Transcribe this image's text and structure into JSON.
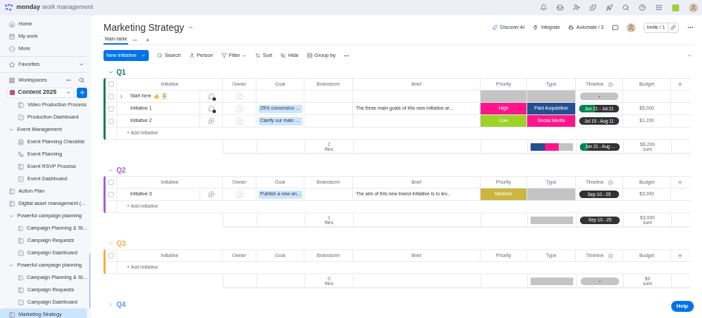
{
  "top_bar": {
    "brand": "monday",
    "product": "work management"
  },
  "sidebar": {
    "nav": [
      {
        "label": "Home",
        "kind": "home"
      },
      {
        "label": "My work",
        "kind": "mywork"
      },
      {
        "label": "More",
        "kind": "more"
      }
    ],
    "favorites": "Favorites",
    "workspaces": "Workspaces",
    "workspace": "Content 2025",
    "items": [
      {
        "label": "Video Production Process",
        "kind": "board",
        "selected": false
      },
      {
        "label": "Production Dashboard",
        "kind": "dashboard",
        "selected": false
      },
      {
        "label": "Event Management",
        "kind": "folder",
        "selected": false,
        "expanded": true,
        "children": [
          {
            "label": "Event Planning Checklist",
            "kind": "doc",
            "selected": false
          },
          {
            "label": "Event Planning",
            "kind": "workflow",
            "selected": false
          },
          {
            "label": "Event RSVP Process",
            "kind": "board",
            "selected": false
          },
          {
            "label": "Event Dashboard",
            "kind": "dashboard",
            "selected": false
          }
        ]
      },
      {
        "label": "Action Plan",
        "kind": "board",
        "selected": false
      },
      {
        "label": "Digital asset management (...",
        "kind": "board",
        "selected": false
      },
      {
        "label": "Powerful campaign planning",
        "kind": "folder",
        "selected": false,
        "expanded": true,
        "children": [
          {
            "label": "Campaign Planning & St...",
            "kind": "board",
            "selected": false
          },
          {
            "label": "Campaign Requests",
            "kind": "board",
            "selected": false
          },
          {
            "label": "Campaign Dashboard",
            "kind": "dashboard",
            "selected": false
          }
        ]
      },
      {
        "label": "Powerful campaign planning",
        "kind": "folder",
        "selected": false,
        "expanded": true,
        "children": [
          {
            "label": "Campaign Planning & St...",
            "kind": "board",
            "selected": false
          },
          {
            "label": "Campaign Requests",
            "kind": "board",
            "selected": false
          },
          {
            "label": "Campaign Dashboard",
            "kind": "dashboard",
            "selected": false
          }
        ]
      },
      {
        "label": "Marketing Strategy",
        "kind": "board",
        "selected": true
      }
    ]
  },
  "board": {
    "title": "Marketing Strategy",
    "actions": [
      "Discover AI",
      "Integrate",
      "Automate / 3"
    ],
    "invite": "Invite / 1",
    "tabs": [
      {
        "label": "Main table",
        "selected": true
      }
    ],
    "toolbar": {
      "primary": "New initiative",
      "items": [
        "Search",
        "Person",
        "Filter",
        "Sort",
        "Hide",
        "Group by"
      ]
    }
  },
  "groups": [
    {
      "title": "Q1",
      "color": "#037f4c",
      "expanded": true,
      "all_checked": false,
      "columns": [
        "Initiative",
        "Owner",
        "Goal",
        "Brainstorm",
        "Brief",
        "Priority",
        "Type",
        "Timeline",
        "Budget"
      ],
      "add_label": "+ Add initiative",
      "rows": [
        {
          "name": "Start here",
          "checked": false,
          "expandable": true,
          "count": "1",
          "has_updates": true,
          "priority": {
            "color": "#c4c4c4"
          },
          "type": {
            "color": "#c4c4c4"
          },
          "timeline": {
            "kind": "empty",
            "label": "-"
          }
        },
        {
          "name": "Initiative 1",
          "checked": false,
          "has_updates": true,
          "goal": "25% conversion ...",
          "brief": "The three main goals of this new initiative ar...",
          "priority": {
            "label": "High",
            "color": "#ff158a"
          },
          "type": {
            "label": "Paid Acquisition",
            "color": "#225091"
          },
          "timeline": {
            "kind": "range",
            "label": "Jun 21 - Jul 21",
            "level": 0.4
          },
          "budget": "$5,000"
        },
        {
          "name": "Initiative 2",
          "checked": false,
          "has_updates": false,
          "goal": "Clarify our main ...",
          "priority": {
            "label": "Low",
            "color": "#9cd326"
          },
          "type": {
            "label": "Social Media",
            "color": "#ff158a"
          },
          "timeline": {
            "kind": "range",
            "label": "Jul 15 - Aug 11"
          },
          "budget": "$1,200"
        }
      ],
      "summary": {
        "files": "2",
        "files_label": "files",
        "type_mix": [
          {
            "color": "#225091"
          },
          {
            "color": "#ff158a"
          },
          {
            "color": "#c4c4c4"
          }
        ],
        "timeline": {
          "kind": "range",
          "label": "Jun 21 - Aug ...",
          "level": 0.2
        },
        "budget": "$6,200",
        "budget_label": "sum"
      }
    },
    {
      "title": "Q2",
      "color": "#a25ddc",
      "expanded": true,
      "all_checked": false,
      "columns": [
        "Initiative",
        "Owner",
        "Goal",
        "Brainstorm",
        "Brief",
        "Priority",
        "Type",
        "Timeline",
        "Budget"
      ],
      "add_label": "+ Add initiative",
      "rows": [
        {
          "name": "Initiative 3",
          "checked": false,
          "has_updates": false,
          "goal": "Publish a new an...",
          "brief": "The aim of this new brand initiative is to lev...",
          "priority": {
            "label": "Medium",
            "color": "#cab641"
          },
          "type": {
            "color": "#c4c4c4"
          },
          "timeline": {
            "kind": "range",
            "label": "Sep 10 - 25"
          },
          "budget": "$3,000"
        }
      ],
      "summary": {
        "files": "1",
        "files_label": "files",
        "type_mix": [
          {
            "color": "#c4c4c4"
          }
        ],
        "timeline": {
          "kind": "range",
          "label": "Sep 10 - 25"
        },
        "budget": "$3,000",
        "budget_label": "sum"
      }
    },
    {
      "title": "Q3",
      "color": "#fdab3d",
      "expanded": true,
      "all_checked": false,
      "columns": [
        "Initiative",
        "Owner",
        "Goal",
        "Brainstorm",
        "Brief",
        "Priority",
        "Type",
        "Timeline",
        "Budget"
      ],
      "add_label": "+ Add initiative",
      "summary": {
        "files": "0",
        "files_label": "files",
        "type_mix": [
          {
            "color": "#c4c4c4"
          }
        ],
        "timeline": {
          "kind": "empty",
          "label": "-"
        },
        "budget": "$0",
        "budget_label": "sum"
      }
    },
    {
      "title": "Q4",
      "color": "#579bfc",
      "expanded": false
    }
  ],
  "help": "Help"
}
